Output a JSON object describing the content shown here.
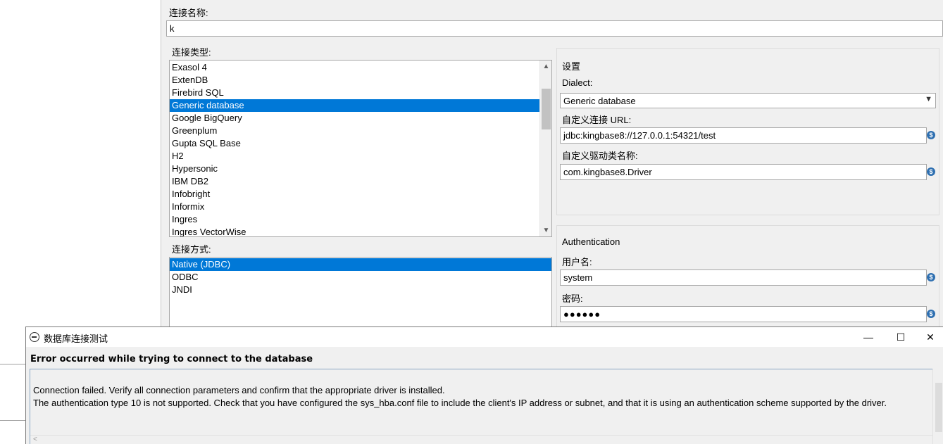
{
  "form": {
    "connection_name_label": "连接名称:",
    "connection_name_value": "k",
    "connection_type_label": "连接类型:",
    "connection_types": [
      {
        "label": "Exasol 4"
      },
      {
        "label": "ExtenDB"
      },
      {
        "label": "Firebird SQL"
      },
      {
        "label": "Generic database",
        "selected": true
      },
      {
        "label": "Google BigQuery"
      },
      {
        "label": "Greenplum"
      },
      {
        "label": "Gupta SQL Base"
      },
      {
        "label": "H2"
      },
      {
        "label": "Hypersonic"
      },
      {
        "label": "IBM DB2"
      },
      {
        "label": "Infobright"
      },
      {
        "label": "Informix"
      },
      {
        "label": "Ingres"
      },
      {
        "label": "Ingres VectorWise"
      }
    ],
    "access_method_label": "连接方式:",
    "access_methods": [
      {
        "label": "Native (JDBC)",
        "selected": true
      },
      {
        "label": "ODBC"
      },
      {
        "label": "JNDI"
      }
    ]
  },
  "settings": {
    "title": "设置",
    "dialect_label": "Dialect:",
    "dialect_value": "Generic database",
    "url_label": "自定义连接 URL:",
    "url_value": "jdbc:kingbase8://127.0.0.1:54321/test",
    "driver_label": "自定义驱动类名称:",
    "driver_value": "com.kingbase8.Driver"
  },
  "auth": {
    "title": "Authentication",
    "username_label": "用户名:",
    "username_value": "system",
    "password_label": "密码:",
    "password_value": "●●●●●●"
  },
  "icons": {
    "variable": "variable-icon",
    "scroll_up": "▲",
    "scroll_down": "▼",
    "dropdown": "▼"
  },
  "dialog": {
    "title": "数据库连接测试",
    "minimize": "—",
    "maximize": "☐",
    "close": "✕",
    "heading": "Error occurred while trying to connect to the database",
    "line1": "Connection failed. Verify all connection parameters and confirm that the appropriate driver is installed.",
    "line2": "The authentication type 10 is not supported. Check that you have configured the sys_hba.conf file to include the client's IP address or subnet, and that it is using an authentication scheme supported by the driver.",
    "hscroll_left": "<"
  },
  "colors": {
    "selection": "#0078d7",
    "variable_icon": "#2e6fb0"
  }
}
